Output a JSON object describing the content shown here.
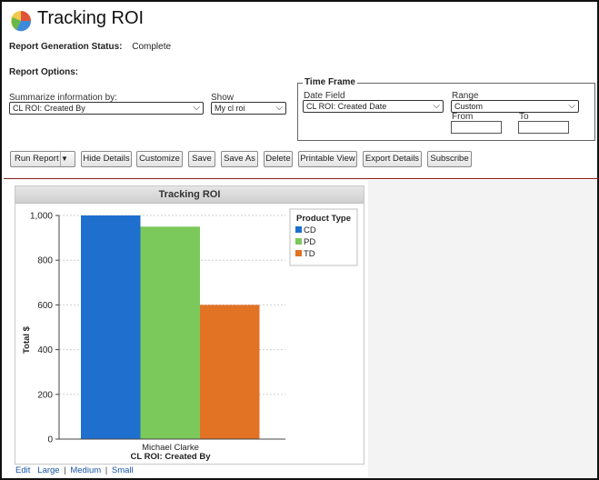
{
  "page": {
    "title": "Tracking ROI"
  },
  "status": {
    "label": "Report Generation Status:",
    "value": "Complete"
  },
  "options": {
    "label": "Report Options:",
    "summarize_label": "Summarize information by:",
    "summarize_value": "CL ROI: Created By",
    "show_label": "Show",
    "show_value": "My cl roi"
  },
  "timeframe": {
    "legend": "Time Frame",
    "date_field_label": "Date Field",
    "date_field_value": "CL ROI: Created Date",
    "range_label": "Range",
    "range_value": "Custom",
    "from_label": "From",
    "to_label": "To"
  },
  "toolbar": {
    "run_report": "Run Report",
    "hide_details": "Hide Details",
    "customize": "Customize",
    "save": "Save",
    "save_as": "Save As",
    "delete": "Delete",
    "printable_view": "Printable View",
    "export_details": "Export Details",
    "subscribe": "Subscribe"
  },
  "chart_links": {
    "edit": "Edit",
    "large": "Large",
    "medium": "Medium",
    "small": "Small"
  },
  "chart_data": {
    "type": "bar",
    "title": "Tracking ROI",
    "categories": [
      "Michael Clarke"
    ],
    "xlabel": "CL ROI: Created By",
    "ylabel": "Total $",
    "ylim": [
      0,
      1000
    ],
    "yticks": [
      "0",
      "200",
      "400",
      "600",
      "800",
      "1,000"
    ],
    "legend_title": "Product Type",
    "legend_position": "top-right",
    "grid": true,
    "series": [
      {
        "name": "CD",
        "values": [
          1000
        ],
        "color": "#1f6fcf"
      },
      {
        "name": "PD",
        "values": [
          950
        ],
        "color": "#7bc95a"
      },
      {
        "name": "TD",
        "values": [
          600
        ],
        "color": "#e27224"
      }
    ]
  }
}
